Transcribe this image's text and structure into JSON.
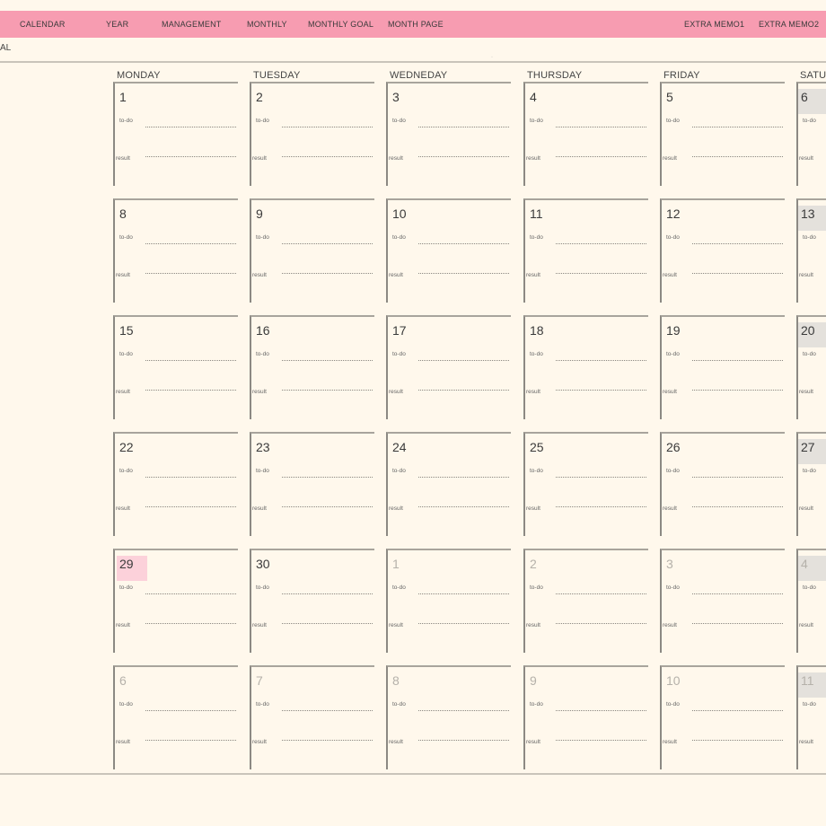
{
  "nav": {
    "calendar": "CALENDAR",
    "year": "YEAR",
    "management": "MANAGEMENT",
    "monthly": "MONTHLY",
    "monthly_goal": "MONTHLY GOAL",
    "month_page": "MONTH PAGE",
    "extra_memo1": "EXTRA MEMO1",
    "extra_memo2": "EXTRA MEMO2"
  },
  "subtitle": "AL",
  "days": [
    "MONDAY",
    "TUESDAY",
    "WEDNEDAY",
    "THURSDAY",
    "FRIDAY",
    "SATU"
  ],
  "labels": {
    "todo": "to-do",
    "result": "result"
  },
  "weeks": [
    [
      {
        "d": "1"
      },
      {
        "d": "2"
      },
      {
        "d": "3"
      },
      {
        "d": "4"
      },
      {
        "d": "5"
      },
      {
        "d": "6"
      }
    ],
    [
      {
        "d": "8"
      },
      {
        "d": "9"
      },
      {
        "d": "10"
      },
      {
        "d": "11"
      },
      {
        "d": "12"
      },
      {
        "d": "13"
      }
    ],
    [
      {
        "d": "15"
      },
      {
        "d": "16"
      },
      {
        "d": "17"
      },
      {
        "d": "18"
      },
      {
        "d": "19"
      },
      {
        "d": "20"
      }
    ],
    [
      {
        "d": "22"
      },
      {
        "d": "23"
      },
      {
        "d": "24"
      },
      {
        "d": "25"
      },
      {
        "d": "26"
      },
      {
        "d": "27"
      }
    ],
    [
      {
        "d": "29",
        "today": true
      },
      {
        "d": "30"
      },
      {
        "d": "1",
        "other": true
      },
      {
        "d": "2",
        "other": true
      },
      {
        "d": "3",
        "other": true
      },
      {
        "d": "4",
        "other": true
      }
    ],
    [
      {
        "d": "6",
        "other": true
      },
      {
        "d": "7",
        "other": true
      },
      {
        "d": "8",
        "other": true
      },
      {
        "d": "9",
        "other": true
      },
      {
        "d": "10",
        "other": true
      },
      {
        "d": "11",
        "other": true
      }
    ]
  ],
  "colors": {
    "background": "#fff8ec",
    "nav_bar": "#f79cb1",
    "today_highlight": "#fcd1da",
    "saturday_highlight": "#e4e1dc"
  }
}
